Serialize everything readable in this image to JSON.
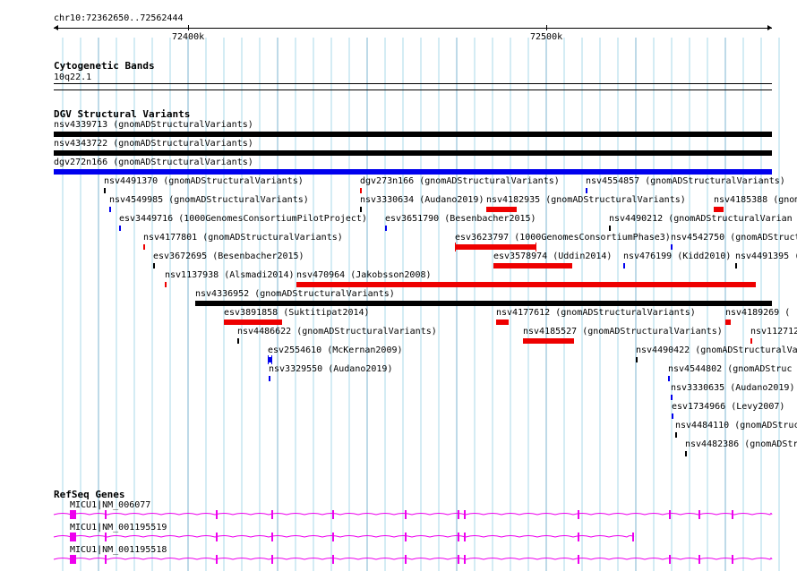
{
  "ruler": {
    "location": "chr10:72362650..72562444",
    "ticks": [
      {
        "label": "72400k",
        "pos": 72400000
      },
      {
        "label": "72500k",
        "pos": 72500000
      }
    ],
    "start": 72362650,
    "end": 72562444
  },
  "tracks": {
    "cytoband": {
      "title": "Cytogenetic Bands",
      "band": "10q22.1"
    },
    "dgv": {
      "title": "DGV Structural Variants"
    },
    "refseq": {
      "title": "RefSeq Genes"
    }
  },
  "colors": {
    "loss": "#ee0000",
    "gain": "#0000ee",
    "complex": "#000000",
    "gene": "#ee00ee",
    "grid": "#a8d8ea"
  },
  "variants": [
    {
      "label": "nsv4339713 (gnomADStructuralVariants)",
      "color": "black"
    },
    {
      "label": "nsv4343722 (gnomADStructuralVariants)",
      "color": "black"
    },
    {
      "label": "dgv272n166 (gnomADStructuralVariants)",
      "color": "blue"
    },
    {
      "label": "nsv4491370 (gnomADStructuralVariants)",
      "color": "black"
    },
    {
      "label": "dgv273n166 (gnomADStructuralVariants)",
      "color": "red"
    },
    {
      "label": "nsv4554857 (gnomADStructuralVariants)",
      "color": "blue"
    },
    {
      "label": "nsv4549985 (gnomADStructuralVariants)",
      "color": "blue"
    },
    {
      "label": "nsv3330634 (Audano2019)",
      "color": "black"
    },
    {
      "label": "nsv4182935 (gnomADStructuralVariants)",
      "color": "red"
    },
    {
      "label": "nsv4185388 (gnom",
      "color": "red"
    },
    {
      "label": "esv3449716 (1000GenomesConsortiumPilotProject)",
      "color": "blue"
    },
    {
      "label": "esv3651790 (Besenbacher2015)",
      "color": "blue"
    },
    {
      "label": "nsv4490212 (gnomADStructuralVarian",
      "color": "black"
    },
    {
      "label": "nsv4177801 (gnomADStructuralVariants)",
      "color": "red"
    },
    {
      "label": "esv3623797 (1000GenomesConsortiumPhase3)",
      "color": "red"
    },
    {
      "label": "nsv4542750 (gnomADStruct",
      "color": "blue"
    },
    {
      "label": "esv3672695 (Besenbacher2015)",
      "color": "black"
    },
    {
      "label": "esv3578974 (Uddin2014)",
      "color": "red"
    },
    {
      "label": "nsv476199 (Kidd2010)",
      "color": "blue"
    },
    {
      "label": "nsv4491395 (",
      "color": "black"
    },
    {
      "label": "nsv1137938 (Alsmadi2014)",
      "color": "red"
    },
    {
      "label": "nsv470964 (Jakobsson2008)",
      "color": "red"
    },
    {
      "label": "nsv4336952 (gnomADStructuralVariants)",
      "color": "black"
    },
    {
      "label": "esv3891858 (Suktitipat2014)",
      "color": "red"
    },
    {
      "label": "nsv4177612 (gnomADStructuralVariants)",
      "color": "red"
    },
    {
      "label": "nsv4189269 (",
      "color": "red"
    },
    {
      "label": "nsv4486622 (gnomADStructuralVariants)",
      "color": "black"
    },
    {
      "label": "nsv4185527 (gnomADStructuralVariants)",
      "color": "red"
    },
    {
      "label": "nsv112712",
      "color": "red"
    },
    {
      "label": "esv2554610 (McKernan2009)",
      "color": "blue"
    },
    {
      "label": "nsv4490422 (gnomADStructuralVa",
      "color": "black"
    },
    {
      "label": "nsv3329550 (Audano2019)",
      "color": "blue"
    },
    {
      "label": "nsv4544802 (gnomADStruc",
      "color": "blue"
    },
    {
      "label": "nsv3330635 (Audano2019)",
      "color": "blue"
    },
    {
      "label": "esv1734966 (Levy2007)",
      "color": "blue"
    },
    {
      "label": "nsv4484110 (gnomADStruc",
      "color": "black"
    },
    {
      "label": "nsv4482386 (gnomADStruc",
      "color": "black"
    }
  ],
  "genes": [
    {
      "label": "MICU1|NM_006077"
    },
    {
      "label": "MICU1|NM_001195519"
    },
    {
      "label": "MICU1|NM_001195518"
    }
  ]
}
